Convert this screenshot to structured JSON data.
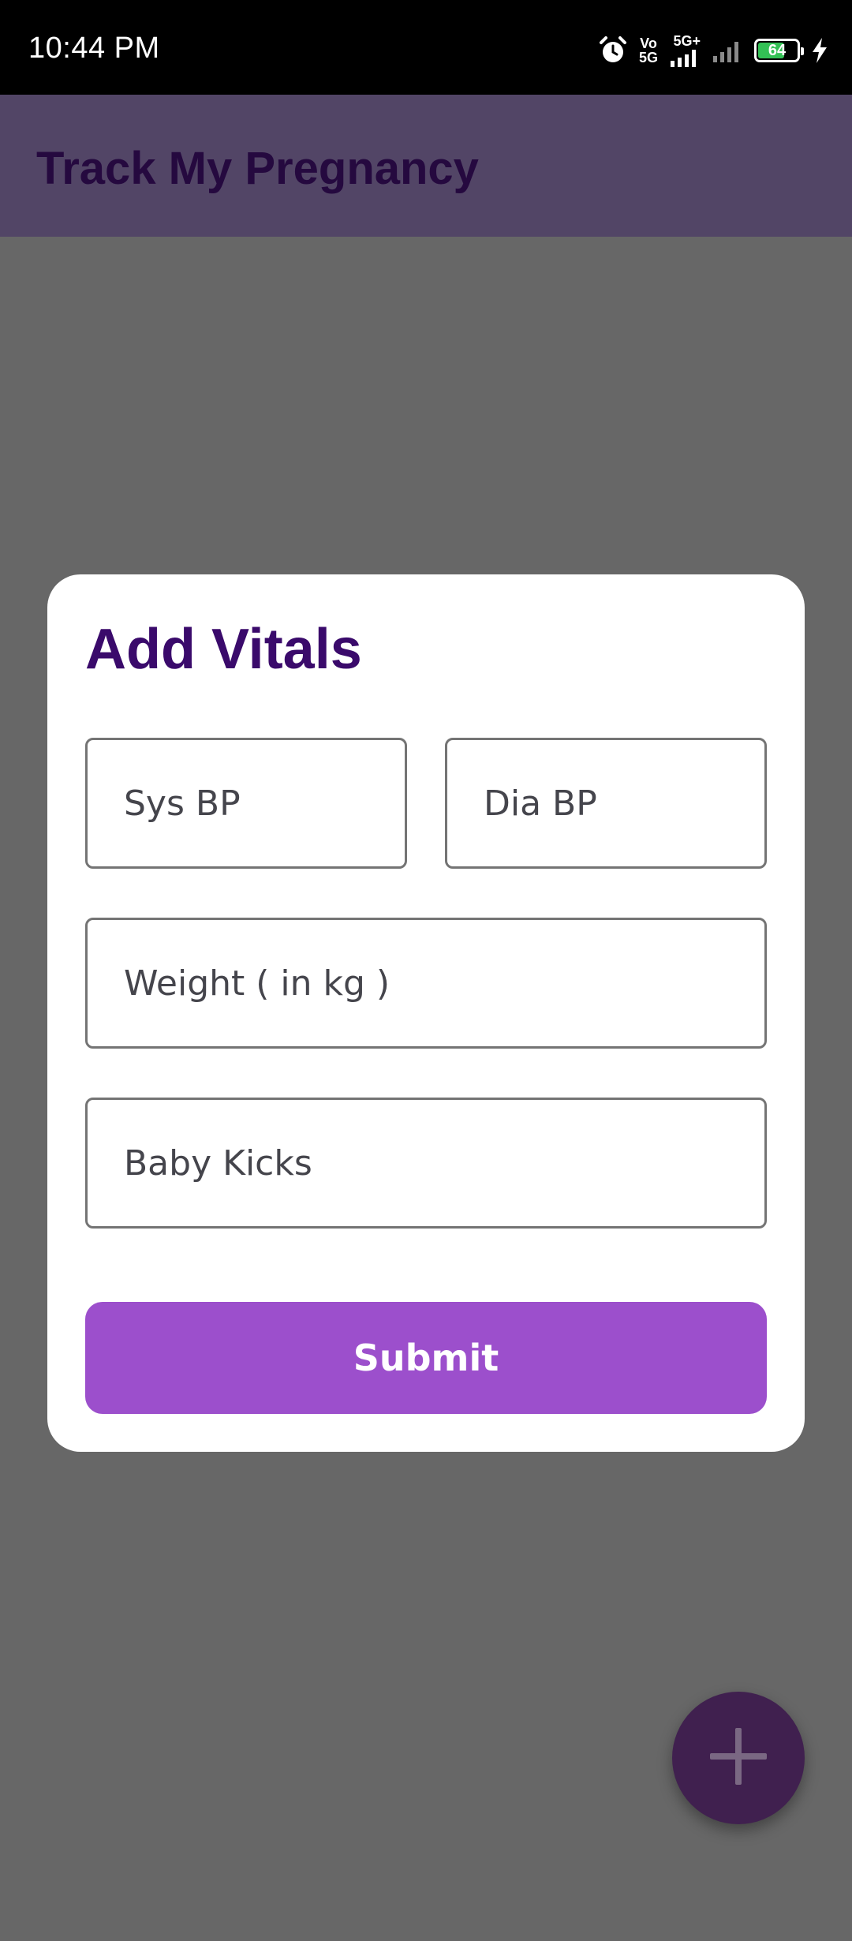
{
  "status_bar": {
    "time": "10:44 PM",
    "network_top": "Vo",
    "network_bottom": "5G",
    "network_type": "5G+",
    "battery_level": "64",
    "battery_fraction": 0.64,
    "battery_color": "#33c155",
    "icons": [
      "alarm-icon",
      "signal-5g-icon",
      "signal-weak-icon",
      "battery-icon",
      "charging-bolt-icon"
    ]
  },
  "app_bar": {
    "title": "Track My Pregnancy",
    "background": "#524566"
  },
  "dialog": {
    "title": "Add Vitals",
    "fields": {
      "sys_bp": {
        "placeholder": "Sys BP",
        "value": ""
      },
      "dia_bp": {
        "placeholder": "Dia BP",
        "value": ""
      },
      "weight": {
        "placeholder": "Weight ( in kg )",
        "value": ""
      },
      "baby_kicks": {
        "placeholder": "Baby Kicks",
        "value": ""
      }
    },
    "submit_label": "Submit",
    "submit_color": "#9c4fcc"
  },
  "fab": {
    "icon": "plus-icon",
    "color": "#40204f"
  }
}
